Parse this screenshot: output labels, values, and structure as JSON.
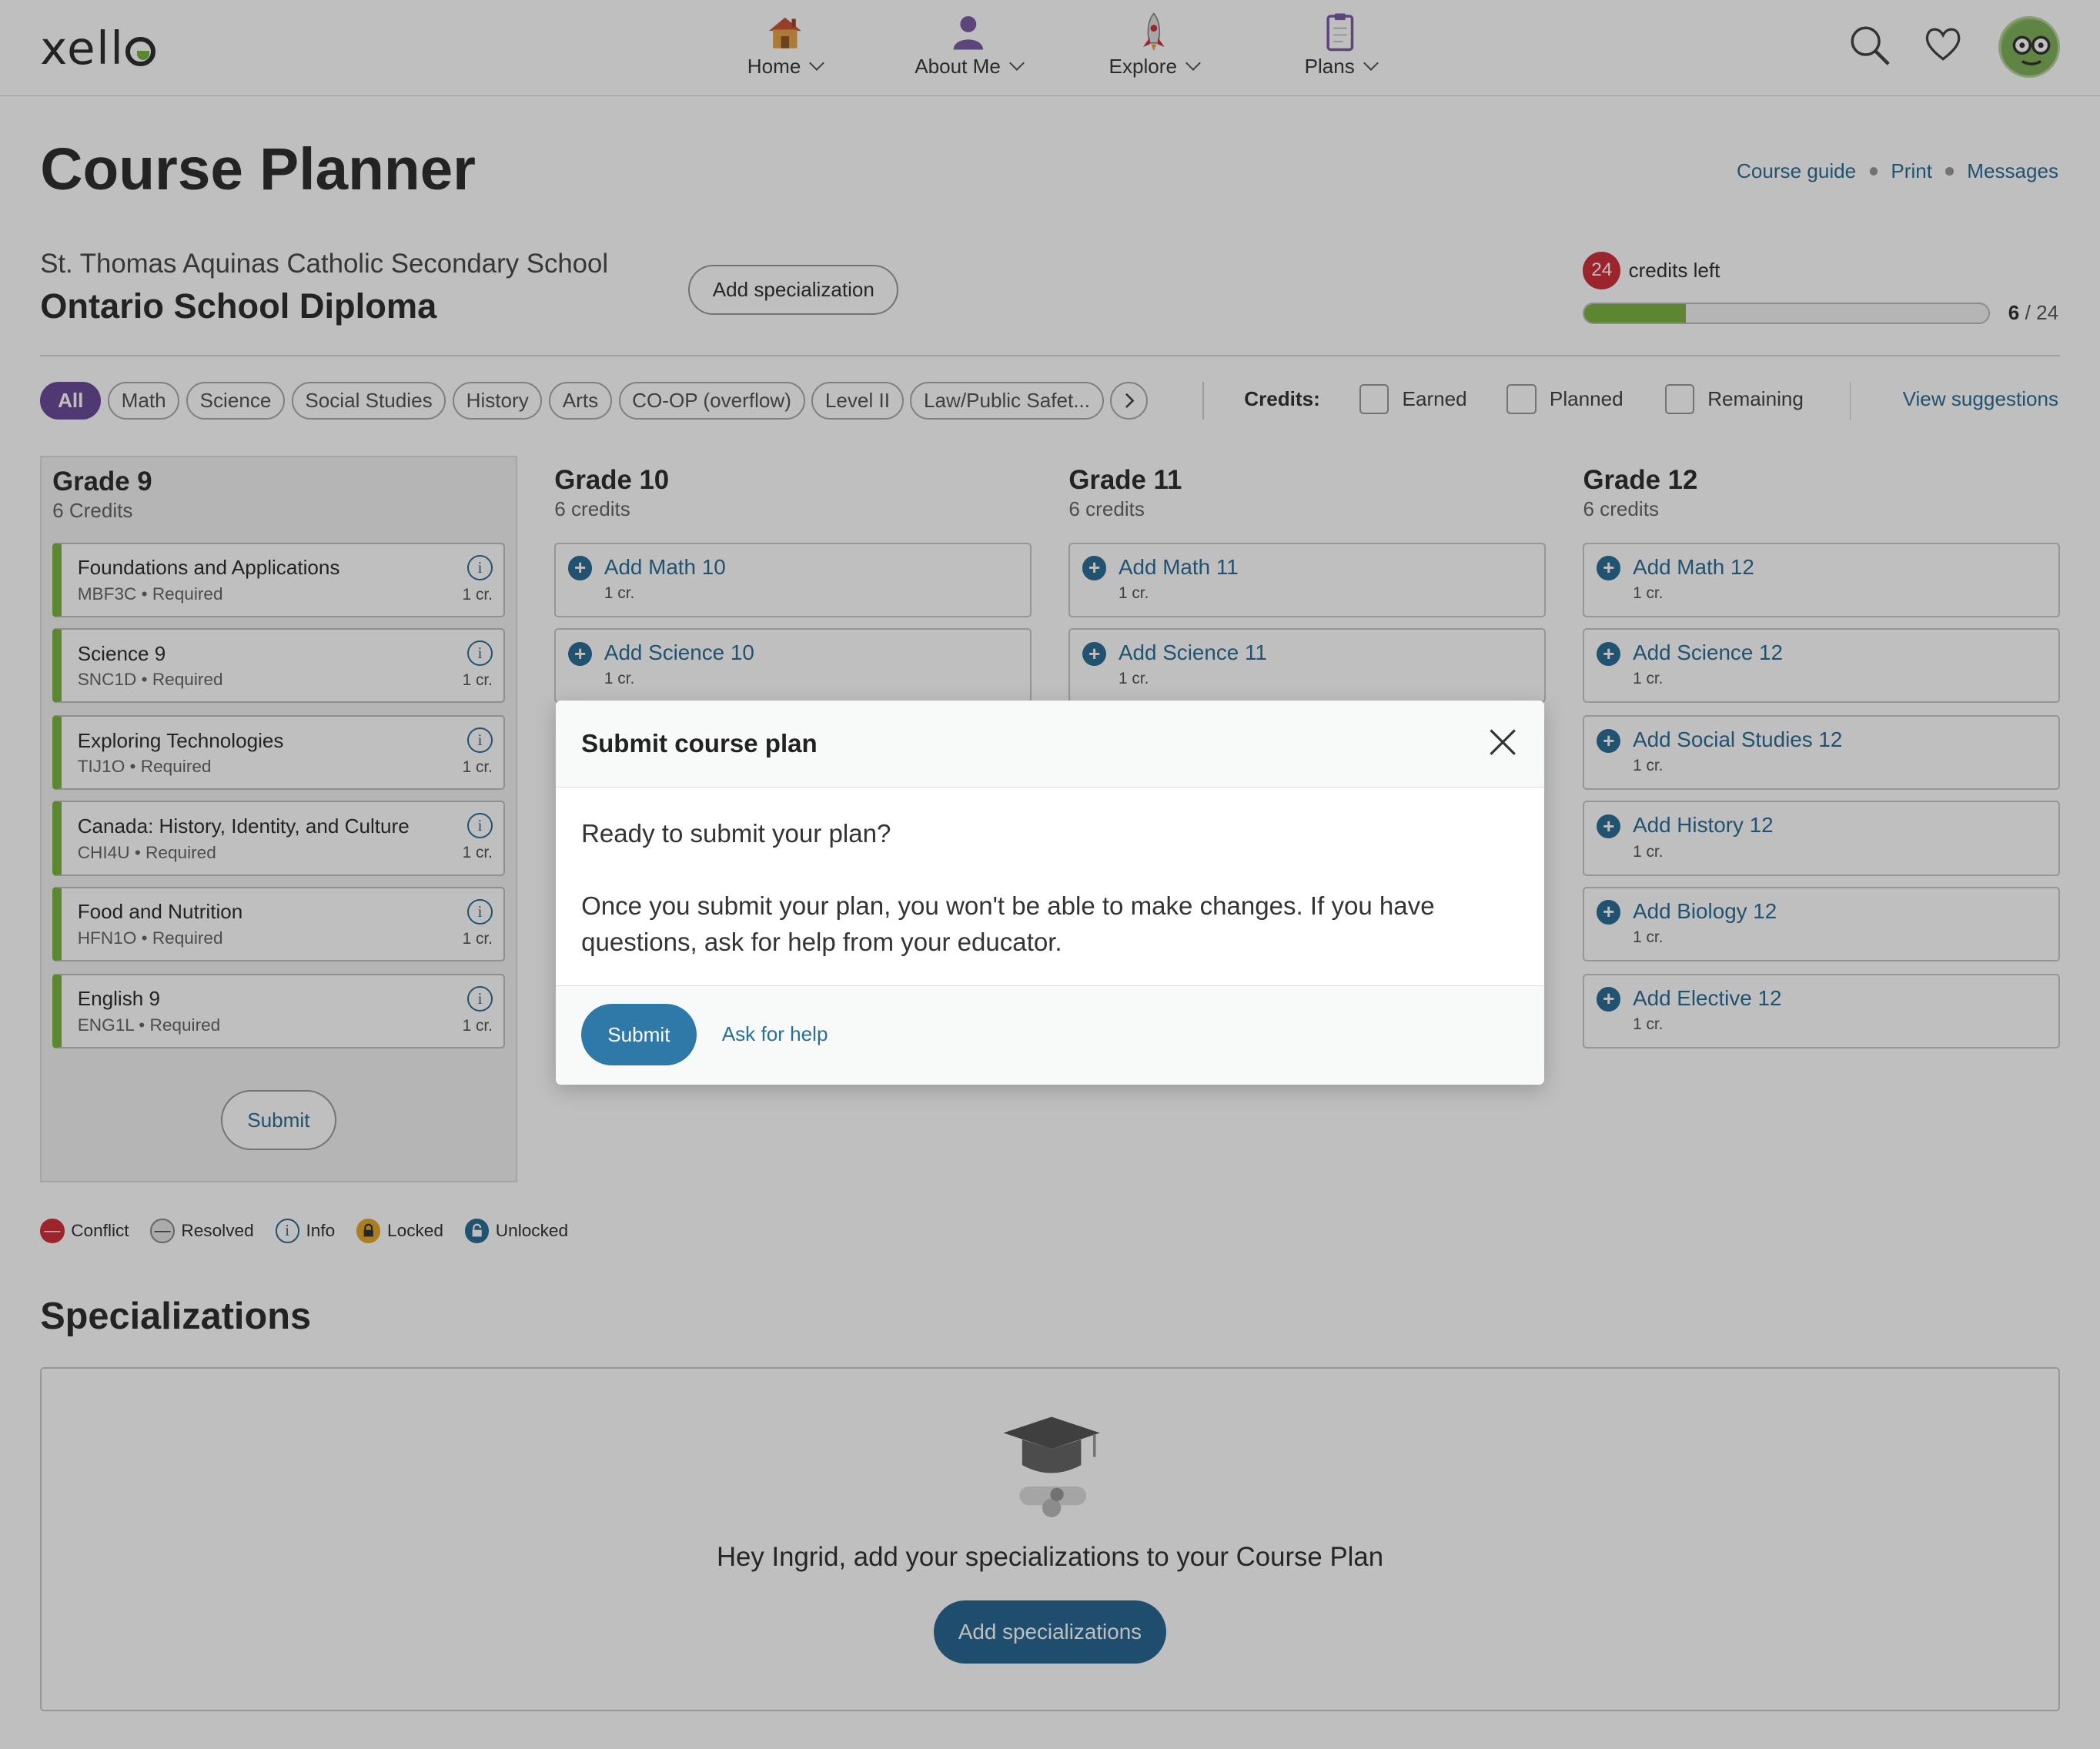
{
  "topbar": {
    "logo": "xello",
    "nav": [
      {
        "label": "Home",
        "icon": "house-icon"
      },
      {
        "label": "About Me",
        "icon": "person-icon"
      },
      {
        "label": "Explore",
        "icon": "rocket-icon"
      },
      {
        "label": "Plans",
        "icon": "clipboard-icon"
      }
    ]
  },
  "page": {
    "title": "Course Planner",
    "links": [
      "Course guide",
      "Print",
      "Messages"
    ],
    "school": "St. Thomas Aquinas Catholic Secondary School",
    "diploma": "Ontario School Diploma",
    "add_specialization": "Add specialization",
    "credits_left_count": "24",
    "credits_left_label": "credits left",
    "progress": {
      "earned": "6",
      "total": "24",
      "separator": "/",
      "fraction": 0.25
    }
  },
  "filters": {
    "chips": [
      "All",
      "Math",
      "Science",
      "Social Studies",
      "History",
      "Arts",
      "CO-OP (overflow)",
      "Level II",
      "Law/Public Safet..."
    ],
    "credits_label": "Credits:",
    "checkboxes": [
      "Earned",
      "Planned",
      "Remaining"
    ],
    "view_suggestions": "View suggestions"
  },
  "grades": {
    "g9": {
      "title": "Grade 9",
      "credits": "6 Credits",
      "submit": "Submit",
      "courses": [
        {
          "name": "Foundations and Applications",
          "code": "MBF3C • Required",
          "cr": "1 cr."
        },
        {
          "name": "Science 9",
          "code": "SNC1D • Required",
          "cr": "1 cr."
        },
        {
          "name": "Exploring Technologies",
          "code": "TIJ1O • Required",
          "cr": "1 cr."
        },
        {
          "name": "Canada: History, Identity, and Culture",
          "code": "CHI4U • Required",
          "cr": "1 cr."
        },
        {
          "name": "Food and Nutrition",
          "code": "HFN1O • Required",
          "cr": "1 cr."
        },
        {
          "name": "English 9",
          "code": "ENG1L • Required",
          "cr": "1 cr."
        }
      ]
    },
    "g10": {
      "title": "Grade 10",
      "credits": "6 credits",
      "adds": [
        {
          "name": "Add Math 10",
          "cr": "1 cr."
        },
        {
          "name": "Add Science 10",
          "cr": "1 cr."
        }
      ]
    },
    "g11": {
      "title": "Grade 11",
      "credits": "6 credits",
      "adds": [
        {
          "name": "Add Math 11",
          "cr": "1 cr."
        },
        {
          "name": "Add Science 11",
          "cr": "1 cr."
        }
      ]
    },
    "g12": {
      "title": "Grade 12",
      "credits": "6 credits",
      "adds": [
        {
          "name": "Add Math 12",
          "cr": "1 cr."
        },
        {
          "name": "Add Science 12",
          "cr": "1 cr."
        },
        {
          "name": "Add Social Studies 12",
          "cr": "1 cr."
        },
        {
          "name": "Add History 12",
          "cr": "1 cr."
        },
        {
          "name": "Add Biology 12",
          "cr": "1 cr."
        },
        {
          "name": "Add Elective 12",
          "cr": "1 cr."
        }
      ]
    }
  },
  "legend": [
    "Conflict",
    "Resolved",
    "Info",
    "Locked",
    "Unlocked"
  ],
  "specializations": {
    "title": "Specializations",
    "message": "Hey Ingrid, add your specializations to your Course Plan",
    "button": "Add specializations"
  },
  "modal": {
    "title": "Submit course plan",
    "line1": "Ready to submit your plan?",
    "line2": "Once you submit your plan, you won't be able to make changes. If you have questions, ask for help from your educator.",
    "submit": "Submit",
    "help": "Ask for help"
  },
  "colors": {
    "accent": "#2c6e96",
    "chip_active": "#6b4d9a",
    "progress": "#7cb342",
    "badge": "#d0323d"
  }
}
